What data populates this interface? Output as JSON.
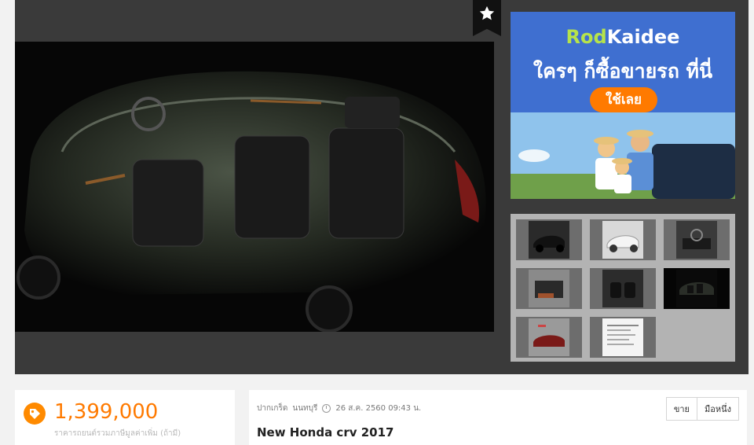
{
  "ad": {
    "logo_part1": "Rod",
    "logo_part2": "Kaidee",
    "tagline": "ใครๆ ก็ซื้อขายรถ ที่นี่",
    "cta": "ใช้เลย",
    "accent_color": "#ff7a00",
    "brand_color": "#3f6fd0"
  },
  "gallery": {
    "favorite_icon": "star-icon",
    "selected_thumbnail": 6,
    "thumbnail_count": 8
  },
  "listing": {
    "price": "1,399,000",
    "price_note": "ราคารถยนต์รวมภาษีมูลค่าเพิ่ม (ถ้ามี)",
    "province": "ปากเกร็ด",
    "district": "นนทบุรี",
    "posted": "26 ส.ค. 2560 09:43 น.",
    "title": "New Honda crv 2017",
    "tabs": [
      "ขาย",
      "มือหนึ่ง"
    ]
  }
}
